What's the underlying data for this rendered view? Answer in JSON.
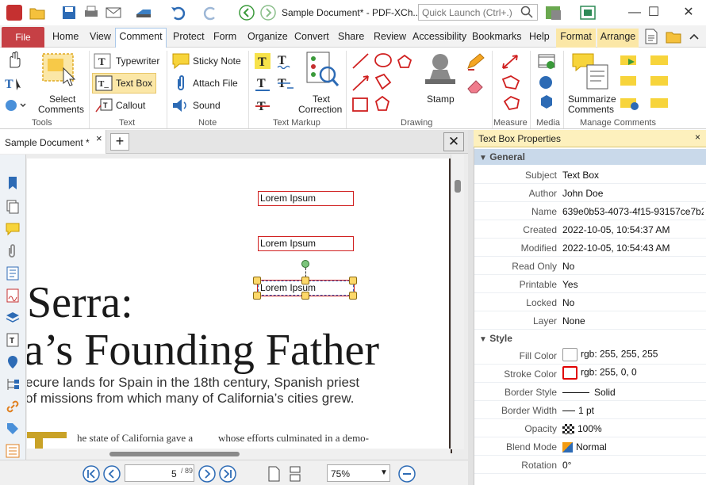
{
  "titlebar": {
    "title": "Sample Document* - PDF-XCh...",
    "quick_launch_placeholder": "Quick Launch (Ctrl+.)",
    "minimize": "—",
    "maximize": "☐",
    "close": "✕"
  },
  "menu": {
    "tabs": [
      "File",
      "Home",
      "View",
      "Comment",
      "Protect",
      "Form",
      "Organize",
      "Convert",
      "Share",
      "Review",
      "Accessibility",
      "Bookmarks",
      "Help"
    ],
    "context_tabs": [
      "Format",
      "Arrange"
    ]
  },
  "ribbon": {
    "tools": {
      "select_label": "Select",
      "comments_label": "Comments",
      "group": "Tools"
    },
    "text": {
      "typewriter": "Typewriter",
      "text_box": "Text Box",
      "callout": "Callout",
      "group": "Text"
    },
    "note": {
      "sticky_note": "Sticky Note",
      "attach_file": "Attach File",
      "sound": "Sound",
      "group": "Note"
    },
    "text_markup": {
      "text_label": "Text",
      "correction_label": "Correction",
      "group": "Text Markup"
    },
    "drawing": {
      "stamp": "Stamp",
      "group": "Drawing"
    },
    "measure": {
      "group": "Measure"
    },
    "media": {
      "group": "Media"
    },
    "manage": {
      "summarize_label": "Summarize",
      "comments_label": "Comments",
      "group": "Manage Comments"
    }
  },
  "document": {
    "tab_title": "Sample Document *",
    "heading_line1": "Serra:",
    "heading_line2": "a’s Founding Father",
    "sub_line1": "ecure lands for Spain in the 18th century, Spanish priest",
    "sub_line2": "of missions from which many of California’s cities grew.",
    "body_col1": "he state of California gave a",
    "body_col2": "whose efforts culminated in a demo-",
    "text_boxes": [
      "Lorem Ipsum",
      "Lorem Ipsum",
      "Lorem Ipsum"
    ]
  },
  "status": {
    "page_current": "5",
    "page_total": "/ 89",
    "zoom": "75%"
  },
  "properties": {
    "title": "Text Box Properties",
    "general_label": "General",
    "style_label": "Style",
    "general": [
      {
        "key": "Subject",
        "value": "Text Box"
      },
      {
        "key": "Author",
        "value": "John Doe"
      },
      {
        "key": "Name",
        "value": "639e0b53-4073-4f15-93157ce7b2..."
      },
      {
        "key": "Created",
        "value": "2022-10-05, 10:54:37 AM"
      },
      {
        "key": "Modified",
        "value": "2022-10-05, 10:54:43 AM"
      },
      {
        "key": "Read Only",
        "value": "No"
      },
      {
        "key": "Printable",
        "value": "Yes"
      },
      {
        "key": "Locked",
        "value": "No"
      },
      {
        "key": "Layer",
        "value": "None"
      }
    ],
    "style": [
      {
        "key": "Fill Color",
        "value": "rgb: 255, 255, 255"
      },
      {
        "key": "Stroke Color",
        "value": "rgb: 255, 0, 0"
      },
      {
        "key": "Border Style",
        "value": "Solid"
      },
      {
        "key": "Border Width",
        "value": "1 pt"
      },
      {
        "key": "Opacity",
        "value": "100%"
      },
      {
        "key": "Blend Mode",
        "value": "Normal"
      },
      {
        "key": "Rotation",
        "value": "0°"
      }
    ]
  },
  "colors": {
    "accent": "#c64045",
    "fill": "#ffffff",
    "stroke": "#ff0000",
    "context_tab": "#fbe7a7"
  }
}
